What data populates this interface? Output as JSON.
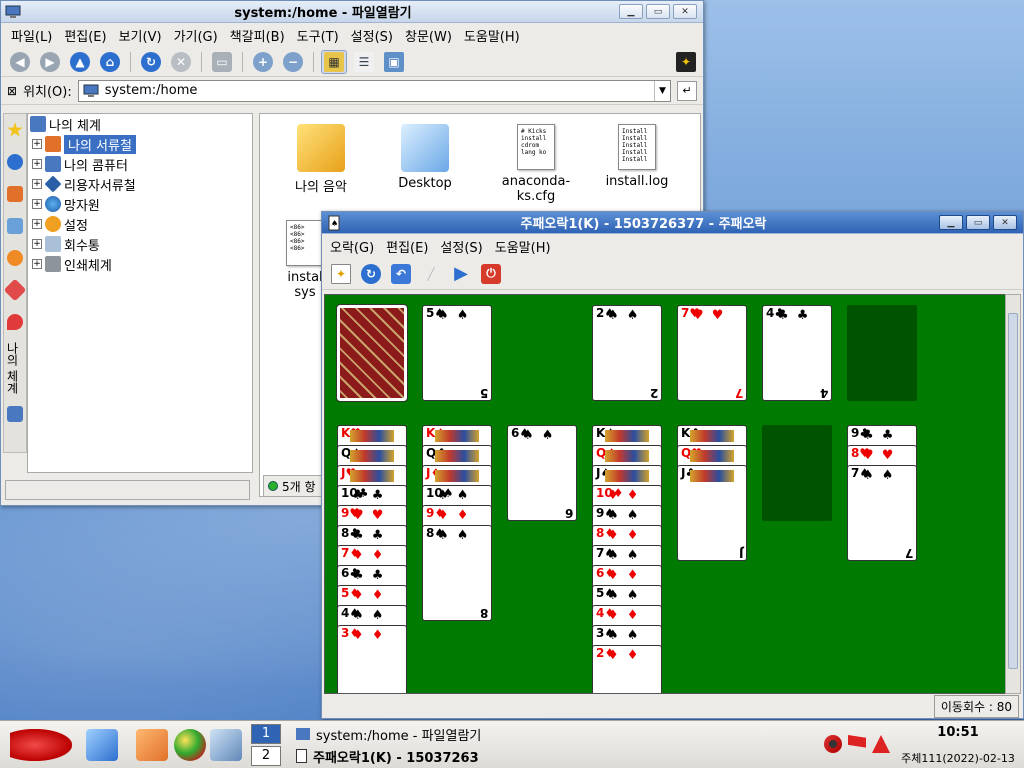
{
  "file_manager": {
    "title": "system:/home - 파일열람기",
    "menu": [
      "파일(L)",
      "편집(E)",
      "보기(V)",
      "가기(G)",
      "책갈피(B)",
      "도구(T)",
      "설정(S)",
      "창문(W)",
      "도움말(H)"
    ],
    "location_label": "위치(O):",
    "location_value": "system:/home",
    "sidebar_tab_label": "나의 체계",
    "tree": [
      {
        "label": "나의 체계",
        "level": 0,
        "selected": false
      },
      {
        "label": "나의 서류철",
        "level": 1,
        "selected": true
      },
      {
        "label": "나의 콤퓨터",
        "level": 1,
        "selected": false
      },
      {
        "label": "리용자서류철",
        "level": 1,
        "selected": false
      },
      {
        "label": "망자원",
        "level": 1,
        "selected": false
      },
      {
        "label": "설정",
        "level": 1,
        "selected": false
      },
      {
        "label": "회수통",
        "level": 1,
        "selected": false
      },
      {
        "label": "인쇄체계",
        "level": 1,
        "selected": false
      }
    ],
    "files": [
      {
        "name": "나의 음악",
        "icon": "music-folder-icon"
      },
      {
        "name": "Desktop",
        "icon": "desktop-folder-icon"
      },
      {
        "name": "anaconda-ks.cfg",
        "icon": "text-file-icon",
        "preview": "# Kicks\ninstall\ncdrom\nlang ko"
      },
      {
        "name": "install.log",
        "icon": "text-file-icon",
        "preview": "Install\nInstall\nInstall\nInstall\nInstall"
      },
      {
        "name": "instal",
        "icon": "text-file-icon",
        "preview": "<86>\n<86>\n<86>\n<86>"
      }
    ],
    "file_partial_line2": "sys",
    "status_text": "5개 항"
  },
  "solitaire": {
    "title": "주패오락1(K) - 1503726377 - 주패오락",
    "menu": [
      "오락(G)",
      "편집(E)",
      "설정(S)",
      "도움말(H)"
    ],
    "moves_label": "이동회수 : 80",
    "stock": {
      "face_down": true
    },
    "waste_top": {
      "rank": "5",
      "suit": "♠"
    },
    "foundations": [
      {
        "rank": "2",
        "suit": "♠"
      },
      {
        "rank": "7",
        "suit": "♥"
      },
      {
        "rank": "4",
        "suit": "♣"
      },
      {
        "empty": true
      }
    ],
    "tableau": [
      {
        "cards": [
          [
            "K",
            "♥"
          ],
          [
            "Q",
            "♠"
          ],
          [
            "J",
            "♥"
          ],
          [
            "10",
            "♣"
          ],
          [
            "9",
            "♥"
          ],
          [
            "8",
            "♣"
          ],
          [
            "7",
            "♦"
          ],
          [
            "6",
            "♣"
          ],
          [
            "5",
            "♦"
          ],
          [
            "4",
            "♠"
          ],
          [
            "3",
            "♦"
          ]
        ]
      },
      {
        "cards": [
          [
            "K",
            "♦"
          ],
          [
            "Q",
            "♣"
          ],
          [
            "J",
            "♦"
          ],
          [
            "10",
            "♠"
          ],
          [
            "9",
            "♦"
          ],
          [
            "8",
            "♠"
          ]
        ]
      },
      {
        "cards": [
          [
            "6",
            "♠"
          ]
        ]
      },
      {
        "cards": [
          [
            "K",
            "♠"
          ],
          [
            "Q",
            "♦"
          ],
          [
            "J",
            "♠"
          ],
          [
            "10",
            "♦"
          ],
          [
            "9",
            "♠"
          ],
          [
            "8",
            "♦"
          ],
          [
            "7",
            "♠"
          ],
          [
            "6",
            "♦"
          ],
          [
            "5",
            "♠"
          ],
          [
            "4",
            "♦"
          ],
          [
            "3",
            "♠"
          ],
          [
            "2",
            "♦"
          ]
        ]
      },
      {
        "cards": [
          [
            "K",
            "♣"
          ],
          [
            "Q",
            "♥"
          ],
          [
            "J",
            "♣"
          ]
        ]
      },
      {
        "cards": []
      },
      {
        "cards": [
          [
            "9",
            "♣"
          ],
          [
            "8",
            "♥"
          ],
          [
            "7",
            "♠"
          ]
        ]
      }
    ]
  },
  "taskbar": {
    "pager": [
      "1",
      "2"
    ],
    "tasks": [
      {
        "label": "system:/home - 파일열람기",
        "active": false
      },
      {
        "label": "주패오락1(K) - 15037263",
        "active": true
      }
    ],
    "time": "10:51",
    "date": "주체111(2022)-02-13"
  }
}
